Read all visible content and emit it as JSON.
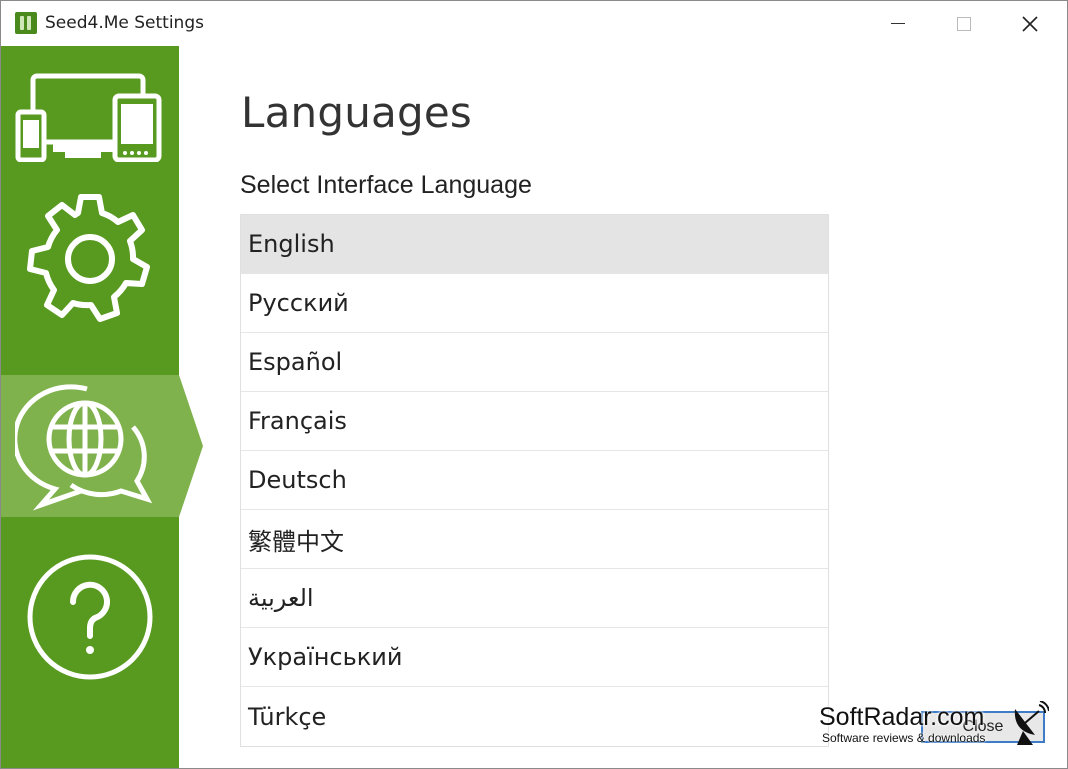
{
  "window": {
    "title": "Seed4.Me Settings"
  },
  "sidebar": {
    "items": [
      {
        "name": "devices",
        "icon": "devices-icon",
        "active": false
      },
      {
        "name": "settings",
        "icon": "gear-icon",
        "active": false
      },
      {
        "name": "languages",
        "icon": "globe-chat-icon",
        "active": true
      },
      {
        "name": "help",
        "icon": "help-icon",
        "active": false
      }
    ],
    "color": "#579a1f",
    "active_color": "#7fb24d"
  },
  "main": {
    "heading": "Languages",
    "subheading": "Select Interface Language",
    "languages": [
      {
        "label": "English",
        "selected": true
      },
      {
        "label": "Русский",
        "selected": false
      },
      {
        "label": "Español",
        "selected": false
      },
      {
        "label": "Français",
        "selected": false
      },
      {
        "label": "Deutsch",
        "selected": false
      },
      {
        "label": "繁體中文",
        "selected": false
      },
      {
        "label": "العربية",
        "selected": false
      },
      {
        "label": "Український",
        "selected": false
      },
      {
        "label": "Türkçe",
        "selected": false
      }
    ],
    "close_label": "Close"
  },
  "watermark": {
    "title": "SoftRadar.com",
    "subtitle": "Software reviews & downloads"
  }
}
